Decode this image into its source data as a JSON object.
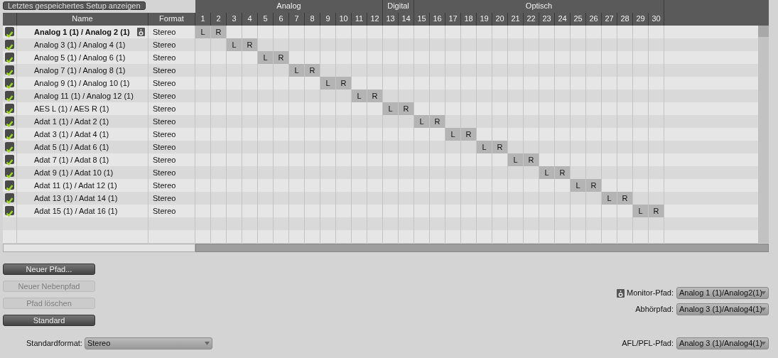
{
  "top_button": {
    "label": "Letztes gespeichertes Setup anzeigen"
  },
  "table": {
    "columns": {
      "name": "Name",
      "format": "Format"
    },
    "groups": [
      {
        "label": "Analog",
        "channels": [
          "1",
          "2",
          "3",
          "4",
          "5",
          "6",
          "7",
          "8",
          "9",
          "10",
          "11",
          "12"
        ]
      },
      {
        "label": "Digital",
        "channels": [
          "13",
          "14"
        ]
      },
      {
        "label": "Optisch",
        "channels": [
          "15",
          "16",
          "17",
          "18",
          "19",
          "20",
          "21",
          "22",
          "23",
          "24",
          "25",
          "26",
          "27",
          "28",
          "29",
          "30"
        ]
      }
    ],
    "rows": [
      {
        "checked": true,
        "name": "Analog 1 (1) / Analog 2 (1)",
        "monitor": true,
        "format": "Stereo",
        "assigned": [
          "L",
          "R"
        ]
      },
      {
        "checked": true,
        "name": "Analog 3 (1) / Analog 4 (1)",
        "monitor": false,
        "format": "Stereo",
        "assigned": [
          "L",
          "R"
        ]
      },
      {
        "checked": true,
        "name": "Analog 5 (1) / Analog 6 (1)",
        "monitor": false,
        "format": "Stereo",
        "assigned": [
          "L",
          "R"
        ]
      },
      {
        "checked": true,
        "name": "Analog 7 (1) / Analog 8 (1)",
        "monitor": false,
        "format": "Stereo",
        "assigned": [
          "L",
          "R"
        ]
      },
      {
        "checked": true,
        "name": "Analog 9 (1) / Analog 10 (1)",
        "monitor": false,
        "format": "Stereo",
        "assigned": [
          "L",
          "R"
        ]
      },
      {
        "checked": true,
        "name": "Analog 11 (1) / Analog 12 (1)",
        "monitor": false,
        "format": "Stereo",
        "assigned": [
          "L",
          "R"
        ]
      },
      {
        "checked": true,
        "name": "AES L (1) / AES R (1)",
        "monitor": false,
        "format": "Stereo",
        "assigned": [
          "L",
          "R"
        ]
      },
      {
        "checked": true,
        "name": "Adat 1 (1) / Adat 2 (1)",
        "monitor": false,
        "format": "Stereo",
        "assigned": [
          "L",
          "R"
        ]
      },
      {
        "checked": true,
        "name": "Adat 3 (1) / Adat 4 (1)",
        "monitor": false,
        "format": "Stereo",
        "assigned": [
          "L",
          "R"
        ]
      },
      {
        "checked": true,
        "name": "Adat 5 (1) / Adat 6 (1)",
        "monitor": false,
        "format": "Stereo",
        "assigned": [
          "L",
          "R"
        ]
      },
      {
        "checked": true,
        "name": "Adat 7 (1) / Adat 8 (1)",
        "monitor": false,
        "format": "Stereo",
        "assigned": [
          "L",
          "R"
        ]
      },
      {
        "checked": true,
        "name": "Adat 9 (1) / Adat 10 (1)",
        "monitor": false,
        "format": "Stereo",
        "assigned": [
          "L",
          "R"
        ]
      },
      {
        "checked": true,
        "name": "Adat 11 (1) / Adat 12 (1)",
        "monitor": false,
        "format": "Stereo",
        "assigned": [
          "L",
          "R"
        ]
      },
      {
        "checked": true,
        "name": "Adat 13 (1) / Adat 14 (1)",
        "monitor": false,
        "format": "Stereo",
        "assigned": [
          "L",
          "R"
        ]
      },
      {
        "checked": true,
        "name": "Adat 15 (1) / Adat 16 (1)",
        "monitor": false,
        "format": "Stereo",
        "assigned": [
          "L",
          "R"
        ]
      }
    ]
  },
  "buttons": [
    {
      "label": "Neuer Pfad...",
      "disabled": false
    },
    {
      "label": "Neuer Nebenpfad",
      "disabled": true
    },
    {
      "label": "Pfad löschen",
      "disabled": true
    },
    {
      "label": "Standard",
      "disabled": false
    }
  ],
  "default_format": {
    "label": "Standardformat:",
    "value": "Stereo"
  },
  "paths": [
    {
      "label": "Monitor-Pfad:",
      "value": "Analog 1 (1)/Analog2(1)",
      "monitor": true
    },
    {
      "label": "Abhörpfad:",
      "value": "Analog 3 (1)/Analog4(1)",
      "monitor": false
    },
    {
      "label": "AFL/PFL-Pfad:",
      "value": "Analog 3 (1)/Analog4(1)",
      "monitor": false
    }
  ]
}
